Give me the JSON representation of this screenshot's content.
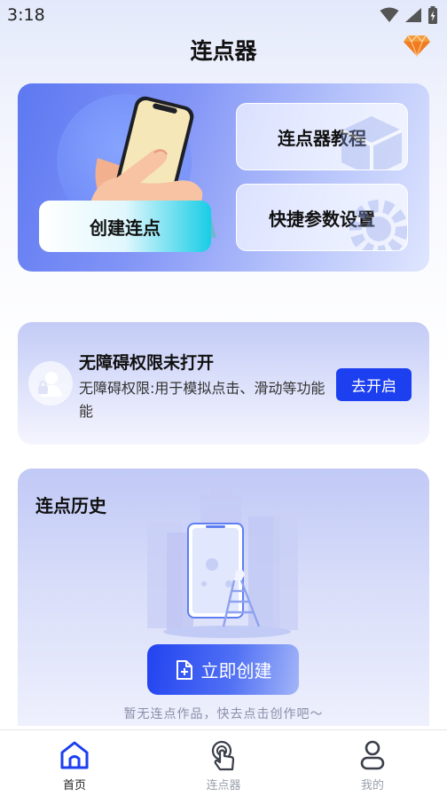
{
  "status_bar": {
    "time": "3:18"
  },
  "header": {
    "title": "连点器"
  },
  "hero": {
    "create_label": "创建连点",
    "tutorial_label": "连点器教程",
    "settings_label": "快捷参数设置"
  },
  "accessibility": {
    "title": "无障碍权限未打开",
    "description": "无障碍权限:用于模拟点击、滑动等功能能",
    "button_label": "去开启"
  },
  "history": {
    "title": "连点历史",
    "create_button_label": "立即创建",
    "hint": "暂无连点作品，快去点击创作吧～"
  },
  "bottom_nav": {
    "items": [
      {
        "label": "首页",
        "icon": "home-icon",
        "active": true
      },
      {
        "label": "连点器",
        "icon": "tap-hand-icon",
        "active": false
      },
      {
        "label": "我的",
        "icon": "user-icon",
        "active": false
      }
    ]
  },
  "colors": {
    "primary": "#1c3ff0",
    "accent_cyan": "#18cde6",
    "vip_orange": "#f39a3a",
    "nav_active": "#1c3ff0",
    "nav_inactive": "#9aa0aa"
  }
}
